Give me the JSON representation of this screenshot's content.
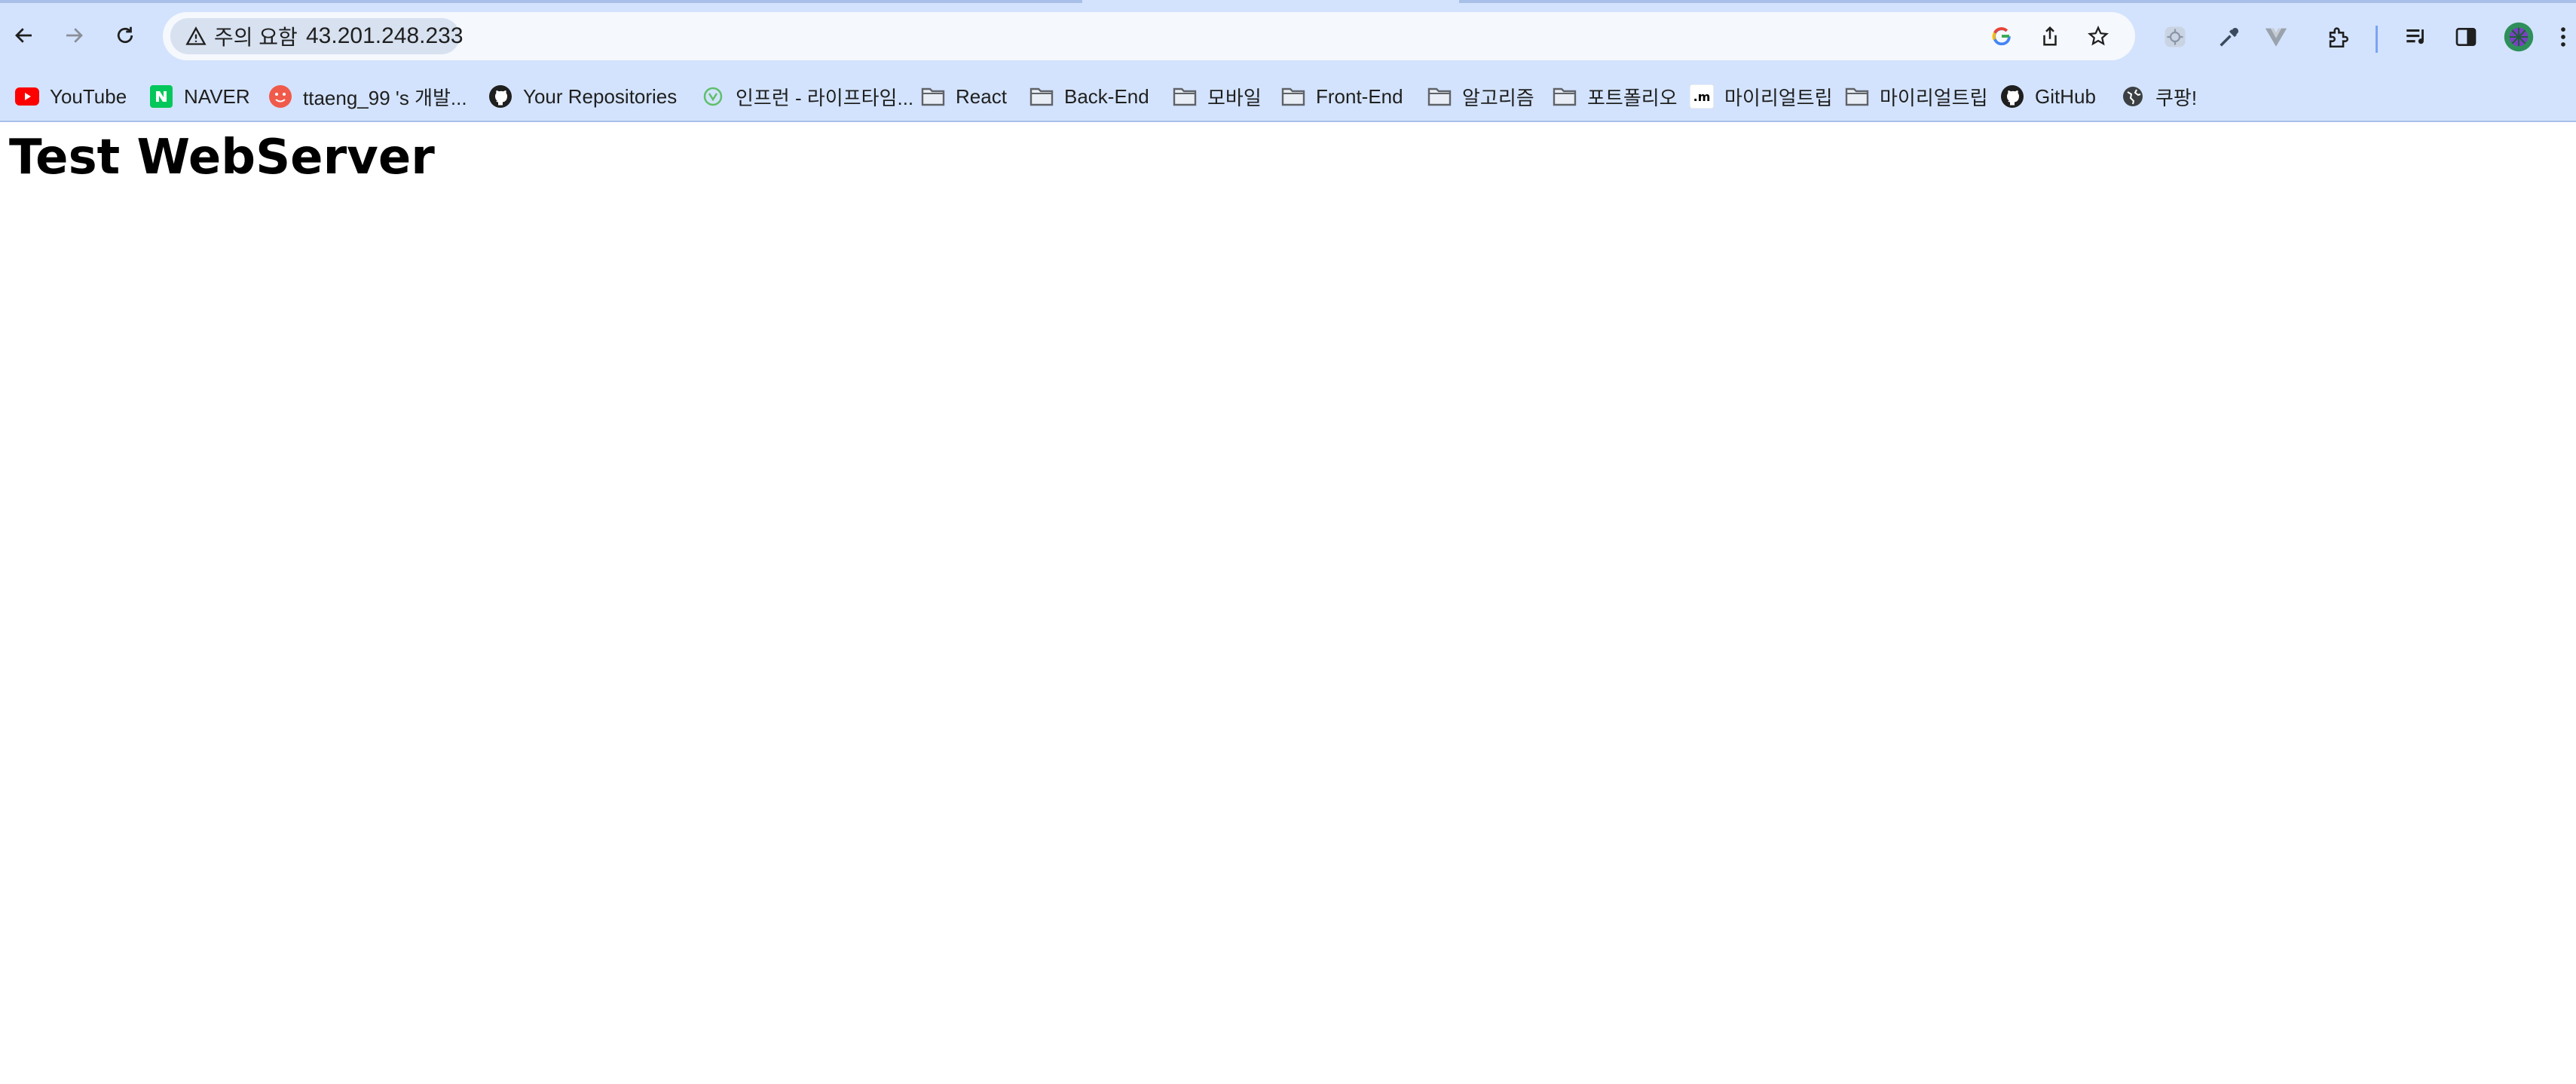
{
  "browser": {
    "security_chip": {
      "label": "주의 요함",
      "icon": "warning-triangle-icon"
    },
    "url": "43.201.248.233",
    "toolbar_icons": [
      "back-arrow-icon",
      "forward-arrow-icon",
      "reload-icon",
      "google-lens-icon",
      "share-icon",
      "star-icon",
      "extension-1-icon",
      "eyedropper-icon",
      "vue-devtools-icon",
      "extensions-puzzle-icon",
      "reading-list-icon",
      "side-panel-icon",
      "profile-avatar-icon",
      "menu-kebab-icon"
    ],
    "accent_color": "#d3e3fd"
  },
  "bookmarks": [
    {
      "label": "YouTube",
      "icon": "youtube-icon"
    },
    {
      "label": "NAVER",
      "icon": "naver-icon"
    },
    {
      "label": "ttaeng_99 's 개발...",
      "icon": "blog-favicon-icon"
    },
    {
      "label": "Your Repositories",
      "icon": "github-icon"
    },
    {
      "label": "인프런 - 라이프타임...",
      "icon": "inflearn-icon"
    },
    {
      "label": "React",
      "icon": "folder-icon"
    },
    {
      "label": "Back-End",
      "icon": "folder-icon"
    },
    {
      "label": "모바일",
      "icon": "folder-icon"
    },
    {
      "label": "Front-End",
      "icon": "folder-icon"
    },
    {
      "label": "알고리즘",
      "icon": "folder-icon"
    },
    {
      "label": "포트폴리오",
      "icon": "folder-icon"
    },
    {
      "label": "마이리얼트립",
      "icon": "myrealtrip-icon"
    },
    {
      "label": "마이리얼트립",
      "icon": "folder-icon"
    },
    {
      "label": "GitHub",
      "icon": "github-icon"
    },
    {
      "label": "쿠팡!",
      "icon": "globe-icon"
    }
  ],
  "page": {
    "heading": "Test WebServer"
  }
}
